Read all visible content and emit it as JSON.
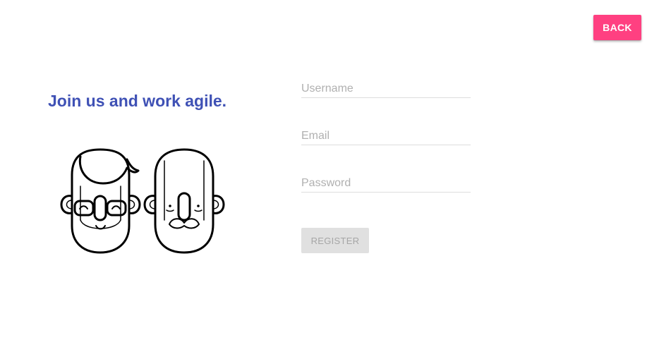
{
  "header": {
    "back_label": "BACK"
  },
  "intro": {
    "headline": "Join us and work agile."
  },
  "form": {
    "username_placeholder": "Username",
    "email_placeholder": "Email",
    "password_placeholder": "Password",
    "register_label": "REGISTER"
  },
  "colors": {
    "accent": "#ff4081",
    "primary": "#3f51b5",
    "disabled_bg": "#e0e0e0",
    "disabled_text": "#a6a6a6"
  },
  "icons": {
    "illustration": "two-bearded-men-faces"
  }
}
